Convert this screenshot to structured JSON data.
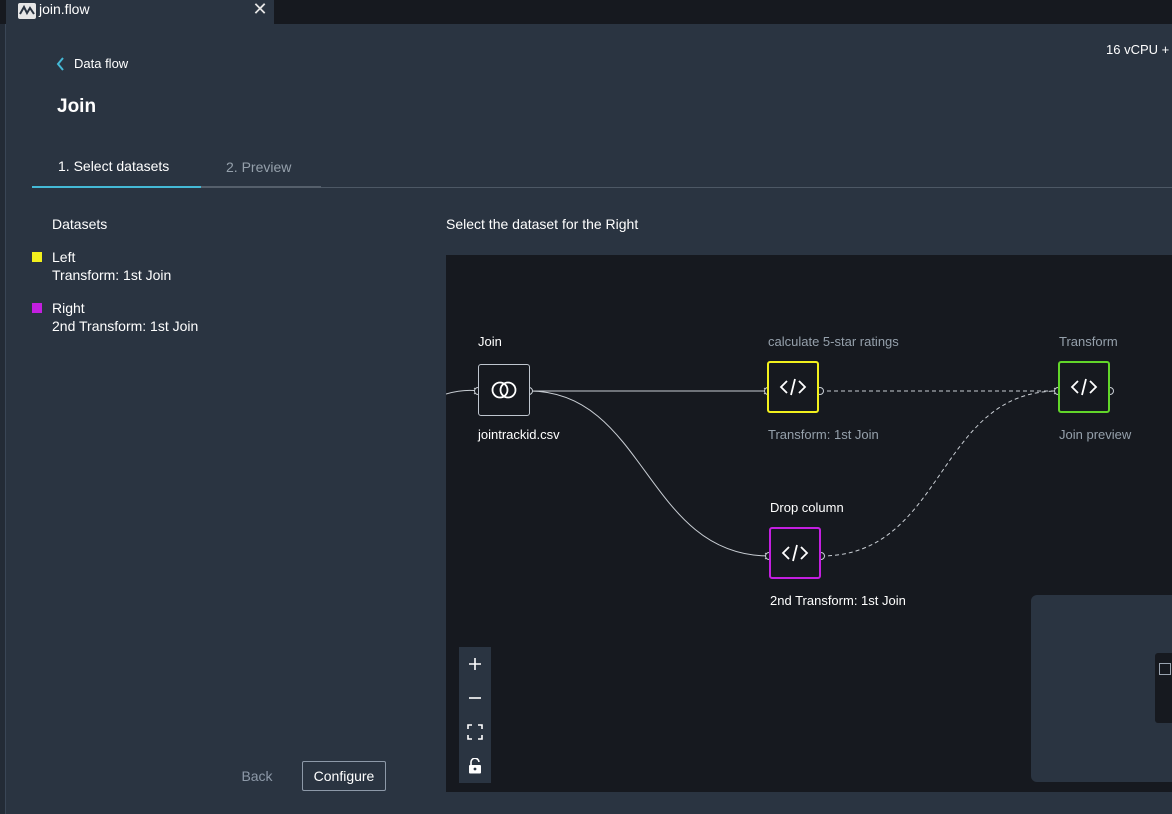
{
  "tab": {
    "title": "join.flow",
    "close_glyph": "✕",
    "icon": "flow-logo-icon"
  },
  "instance": {
    "label": "16 vCPU +"
  },
  "breadcrumb": {
    "label": "Data flow"
  },
  "page": {
    "title": "Join"
  },
  "wizard_tabs": [
    {
      "label": "1. Select datasets",
      "active": true
    },
    {
      "label": "2. Preview",
      "active": false
    }
  ],
  "datasets": {
    "heading": "Datasets",
    "items": [
      {
        "label": "Left",
        "sub": "Transform: 1st Join",
        "color": "#f2f01d"
      },
      {
        "label": "Right",
        "sub": "2nd Transform: 1st Join",
        "color": "#c31fe0"
      }
    ]
  },
  "footer": {
    "back_label": "Back",
    "configure_label": "Configure"
  },
  "canvas": {
    "heading": "Select the dataset for the Right",
    "nodes": [
      {
        "id": "join",
        "title": "Join",
        "sub": "jointrackid.csv",
        "color": "#bfc6cf",
        "icon": "join-icon"
      },
      {
        "id": "ratings",
        "title": "calculate 5-star ratings",
        "sub": "Transform: 1st Join",
        "color": "#f2f01d",
        "icon": "code-icon"
      },
      {
        "id": "transform",
        "title": "Transform",
        "sub": "Join preview",
        "color": "#62d62a",
        "icon": "code-icon"
      },
      {
        "id": "drop",
        "title": "Drop column",
        "sub": "2nd Transform: 1st Join",
        "color": "#c31fe0",
        "icon": "code-icon"
      }
    ],
    "zoom_controls": [
      "zoom-in-icon",
      "zoom-out-icon",
      "fit-view-icon",
      "lock-icon"
    ],
    "colors": {
      "dim_text": "#95a0ab",
      "edge": "#c8cdd3"
    }
  }
}
